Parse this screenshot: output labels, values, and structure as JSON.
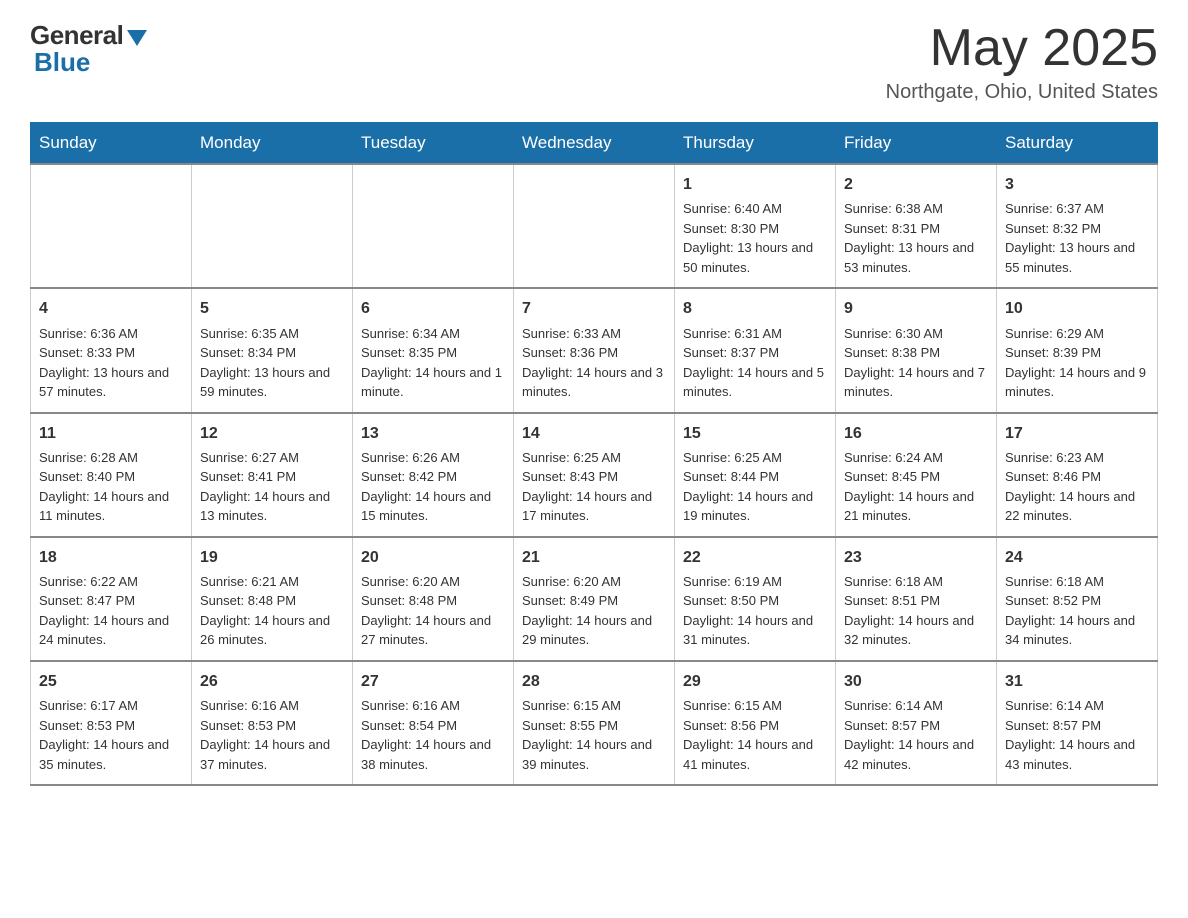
{
  "logo": {
    "general": "General",
    "blue": "Blue"
  },
  "title": "May 2025",
  "location": "Northgate, Ohio, United States",
  "days_of_week": [
    "Sunday",
    "Monday",
    "Tuesday",
    "Wednesday",
    "Thursday",
    "Friday",
    "Saturday"
  ],
  "weeks": [
    [
      {
        "num": "",
        "text": ""
      },
      {
        "num": "",
        "text": ""
      },
      {
        "num": "",
        "text": ""
      },
      {
        "num": "",
        "text": ""
      },
      {
        "num": "1",
        "text": "Sunrise: 6:40 AM\nSunset: 8:30 PM\nDaylight: 13 hours and 50 minutes."
      },
      {
        "num": "2",
        "text": "Sunrise: 6:38 AM\nSunset: 8:31 PM\nDaylight: 13 hours and 53 minutes."
      },
      {
        "num": "3",
        "text": "Sunrise: 6:37 AM\nSunset: 8:32 PM\nDaylight: 13 hours and 55 minutes."
      }
    ],
    [
      {
        "num": "4",
        "text": "Sunrise: 6:36 AM\nSunset: 8:33 PM\nDaylight: 13 hours and 57 minutes."
      },
      {
        "num": "5",
        "text": "Sunrise: 6:35 AM\nSunset: 8:34 PM\nDaylight: 13 hours and 59 minutes."
      },
      {
        "num": "6",
        "text": "Sunrise: 6:34 AM\nSunset: 8:35 PM\nDaylight: 14 hours and 1 minute."
      },
      {
        "num": "7",
        "text": "Sunrise: 6:33 AM\nSunset: 8:36 PM\nDaylight: 14 hours and 3 minutes."
      },
      {
        "num": "8",
        "text": "Sunrise: 6:31 AM\nSunset: 8:37 PM\nDaylight: 14 hours and 5 minutes."
      },
      {
        "num": "9",
        "text": "Sunrise: 6:30 AM\nSunset: 8:38 PM\nDaylight: 14 hours and 7 minutes."
      },
      {
        "num": "10",
        "text": "Sunrise: 6:29 AM\nSunset: 8:39 PM\nDaylight: 14 hours and 9 minutes."
      }
    ],
    [
      {
        "num": "11",
        "text": "Sunrise: 6:28 AM\nSunset: 8:40 PM\nDaylight: 14 hours and 11 minutes."
      },
      {
        "num": "12",
        "text": "Sunrise: 6:27 AM\nSunset: 8:41 PM\nDaylight: 14 hours and 13 minutes."
      },
      {
        "num": "13",
        "text": "Sunrise: 6:26 AM\nSunset: 8:42 PM\nDaylight: 14 hours and 15 minutes."
      },
      {
        "num": "14",
        "text": "Sunrise: 6:25 AM\nSunset: 8:43 PM\nDaylight: 14 hours and 17 minutes."
      },
      {
        "num": "15",
        "text": "Sunrise: 6:25 AM\nSunset: 8:44 PM\nDaylight: 14 hours and 19 minutes."
      },
      {
        "num": "16",
        "text": "Sunrise: 6:24 AM\nSunset: 8:45 PM\nDaylight: 14 hours and 21 minutes."
      },
      {
        "num": "17",
        "text": "Sunrise: 6:23 AM\nSunset: 8:46 PM\nDaylight: 14 hours and 22 minutes."
      }
    ],
    [
      {
        "num": "18",
        "text": "Sunrise: 6:22 AM\nSunset: 8:47 PM\nDaylight: 14 hours and 24 minutes."
      },
      {
        "num": "19",
        "text": "Sunrise: 6:21 AM\nSunset: 8:48 PM\nDaylight: 14 hours and 26 minutes."
      },
      {
        "num": "20",
        "text": "Sunrise: 6:20 AM\nSunset: 8:48 PM\nDaylight: 14 hours and 27 minutes."
      },
      {
        "num": "21",
        "text": "Sunrise: 6:20 AM\nSunset: 8:49 PM\nDaylight: 14 hours and 29 minutes."
      },
      {
        "num": "22",
        "text": "Sunrise: 6:19 AM\nSunset: 8:50 PM\nDaylight: 14 hours and 31 minutes."
      },
      {
        "num": "23",
        "text": "Sunrise: 6:18 AM\nSunset: 8:51 PM\nDaylight: 14 hours and 32 minutes."
      },
      {
        "num": "24",
        "text": "Sunrise: 6:18 AM\nSunset: 8:52 PM\nDaylight: 14 hours and 34 minutes."
      }
    ],
    [
      {
        "num": "25",
        "text": "Sunrise: 6:17 AM\nSunset: 8:53 PM\nDaylight: 14 hours and 35 minutes."
      },
      {
        "num": "26",
        "text": "Sunrise: 6:16 AM\nSunset: 8:53 PM\nDaylight: 14 hours and 37 minutes."
      },
      {
        "num": "27",
        "text": "Sunrise: 6:16 AM\nSunset: 8:54 PM\nDaylight: 14 hours and 38 minutes."
      },
      {
        "num": "28",
        "text": "Sunrise: 6:15 AM\nSunset: 8:55 PM\nDaylight: 14 hours and 39 minutes."
      },
      {
        "num": "29",
        "text": "Sunrise: 6:15 AM\nSunset: 8:56 PM\nDaylight: 14 hours and 41 minutes."
      },
      {
        "num": "30",
        "text": "Sunrise: 6:14 AM\nSunset: 8:57 PM\nDaylight: 14 hours and 42 minutes."
      },
      {
        "num": "31",
        "text": "Sunrise: 6:14 AM\nSunset: 8:57 PM\nDaylight: 14 hours and 43 minutes."
      }
    ]
  ]
}
